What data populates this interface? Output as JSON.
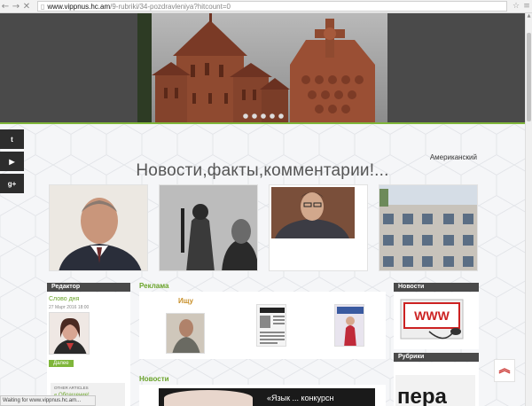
{
  "browser": {
    "url_host": "www.vippnus.hc.am",
    "url_path": "/9-rubriki/34-pozdravleniya?hitcount=0"
  },
  "social": [
    {
      "glyph": "t",
      "icon": "twitter-icon"
    },
    {
      "glyph": "▶",
      "icon": "youtube-icon"
    },
    {
      "glyph": "g+",
      "icon": "google-plus-icon"
    }
  ],
  "language": "Американский",
  "page_title": "Новости,факты,комментарии!...",
  "editor": {
    "header": "Редактор",
    "link": "Слово дня",
    "date": "27 Март 2016 18:00",
    "button": "Далее",
    "other_articles": "OTHER ARTICLES",
    "other_item": "« Обращение!"
  },
  "ads": {
    "header": "Реклама",
    "looking": "Ищу"
  },
  "news_section": "Новости",
  "right": {
    "news_header": "Новости",
    "rubrics_header": "Рубрики"
  },
  "news_banner_text": "«Язык ... конкурсн",
  "status": "Waiting for www.vippnus.hc.am..."
}
